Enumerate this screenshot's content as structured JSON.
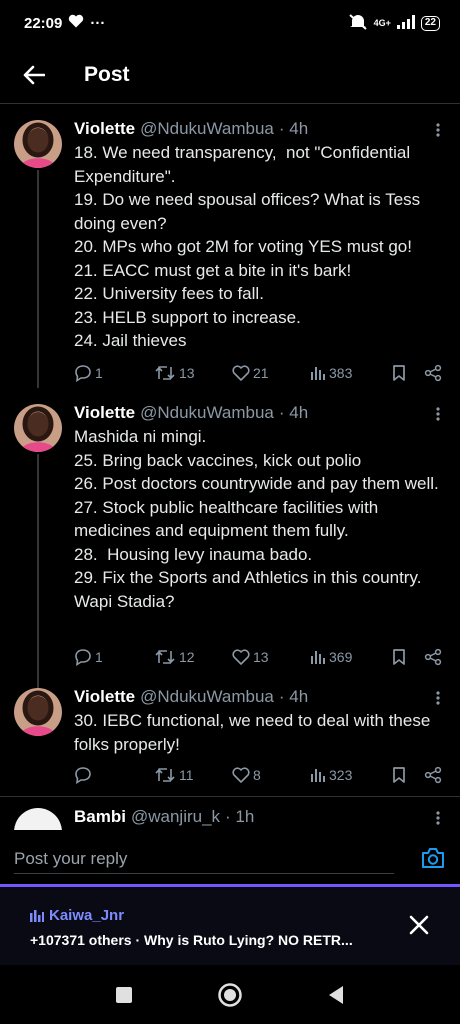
{
  "status_bar": {
    "time": "22:09",
    "dots": "···",
    "network": "4G+",
    "battery": "22"
  },
  "header": {
    "title": "Post"
  },
  "tweets": [
    {
      "name": "Violette",
      "handle": "@NdukuWambua",
      "time": "· 4h",
      "lines": [
        "18. We need transparency,  not \"Confidential Expenditure\".",
        "19. Do we need spousal offices? What is Tess doing even?",
        "20. MPs who got 2M for voting YES must go!",
        "21. EACC must get a bite in it's bark!",
        "22. University fees to fall.",
        "23. HELB support to increase.",
        "24. Jail thieves"
      ],
      "replies": "1",
      "reposts": "13",
      "likes": "21",
      "views": "383"
    },
    {
      "name": "Violette",
      "handle": "@NdukuWambua",
      "time": "· 4h",
      "lines": [
        "Mashida ni mingi.",
        "25. Bring back vaccines, kick out polio",
        "26. Post doctors countrywide and pay them well.",
        "27. Stock public healthcare facilities with medicines and equipment them fully.",
        "28.  Housing levy inauma bado.",
        "29. Fix the Sports and Athletics in this country. Wapi Stadia?"
      ],
      "replies": "1",
      "reposts": "12",
      "likes": "13",
      "views": "369"
    },
    {
      "name": "Violette",
      "handle": "@NdukuWambua",
      "time": "· 4h",
      "lines": [
        "30. IEBC functional, we need to deal with these folks properly!"
      ],
      "replies": "",
      "reposts": "11",
      "likes": "8",
      "views": "323"
    },
    {
      "name": "Bambi",
      "handle": "@wanjiru_k",
      "time": "· 1h"
    }
  ],
  "reply": {
    "placeholder": "Post your reply"
  },
  "space": {
    "host": "Kaiwa_Jnr",
    "text": "+107371 others · Why is Ruto Lying? NO RETR..."
  },
  "colors": {
    "accent": "#1d9bf0",
    "space_purple": "#7856ff",
    "muted": "#8b98a5"
  }
}
